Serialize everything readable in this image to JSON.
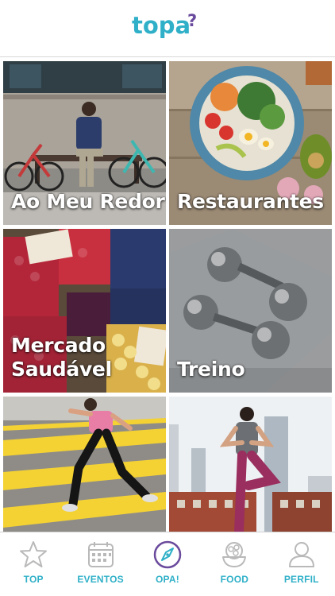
{
  "header": {
    "logo_text": "topa",
    "logo_mark": "?"
  },
  "colors": {
    "brand_teal": "#2fb0c8",
    "brand_purple": "#6a4a9c",
    "tab_icon_gray": "#b9b9b9"
  },
  "tiles": [
    {
      "lines": [
        "Ao Meu Redor"
      ],
      "image": "man-on-bench-with-bicycles"
    },
    {
      "lines": [
        "Restaurantes"
      ],
      "image": "salad-bowl-on-table"
    },
    {
      "lines": [
        "Mercado",
        "Saudável"
      ],
      "image": "fruit-and-vegetable-market"
    },
    {
      "lines": [
        "Treino"
      ],
      "image": "dumbbells"
    },
    {
      "lines": [],
      "image": "woman-running-crosswalk"
    },
    {
      "lines": [],
      "image": "woman-yoga-city"
    }
  ],
  "tabbar": {
    "items": [
      {
        "label": "TOP",
        "icon": "star-icon",
        "active": false
      },
      {
        "label": "EVENTOS",
        "icon": "calendar-icon",
        "active": false
      },
      {
        "label": "OPA!",
        "icon": "compass-icon",
        "active": true
      },
      {
        "label": "FOOD",
        "icon": "food-bowl-icon",
        "active": false
      },
      {
        "label": "PERFIL",
        "icon": "user-icon",
        "active": false
      }
    ]
  }
}
